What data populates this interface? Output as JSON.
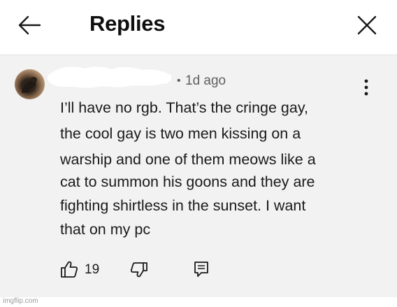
{
  "header": {
    "title": "Replies",
    "back_icon": "arrow-left-icon",
    "close_icon": "close-icon"
  },
  "comment": {
    "author": "",
    "separator": "•",
    "timestamp": "1d ago",
    "text_lines": [
      "I’ll have no rgb. That’s the cringe gay,",
      "the cool gay is two men kissing on a",
      "warship and one of them meows like a",
      "cat to summon his goons and they are",
      "fighting shirtless in the sunset. I want",
      "that on my pc"
    ],
    "like_count": "19",
    "icons": {
      "menu": "more-vert-icon",
      "like": "thumbs-up-icon",
      "dislike": "thumbs-down-icon",
      "reply": "reply-icon"
    }
  },
  "watermark": "imgflip.com",
  "colors": {
    "comment_background": "#f2f2f2",
    "header_background": "#ffffff",
    "secondary_text": "#606060",
    "primary_text": "#0f0f0f"
  }
}
